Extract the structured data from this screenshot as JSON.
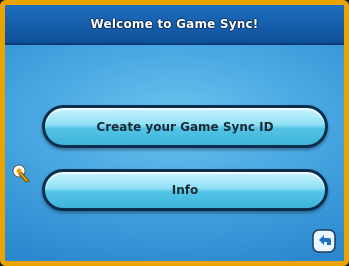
{
  "header": {
    "title": "Welcome to Game Sync!"
  },
  "menu": {
    "create_id_label": "Create your Game Sync ID",
    "info_label": "Info"
  },
  "icons": {
    "pointer": "stylus-pointer-icon",
    "back": "back-arrow-icon"
  },
  "colors": {
    "frame": "#e9a400",
    "title_bar": "#1f6fbf",
    "background": "#4aa8e2",
    "button": "#8fe0f4"
  }
}
